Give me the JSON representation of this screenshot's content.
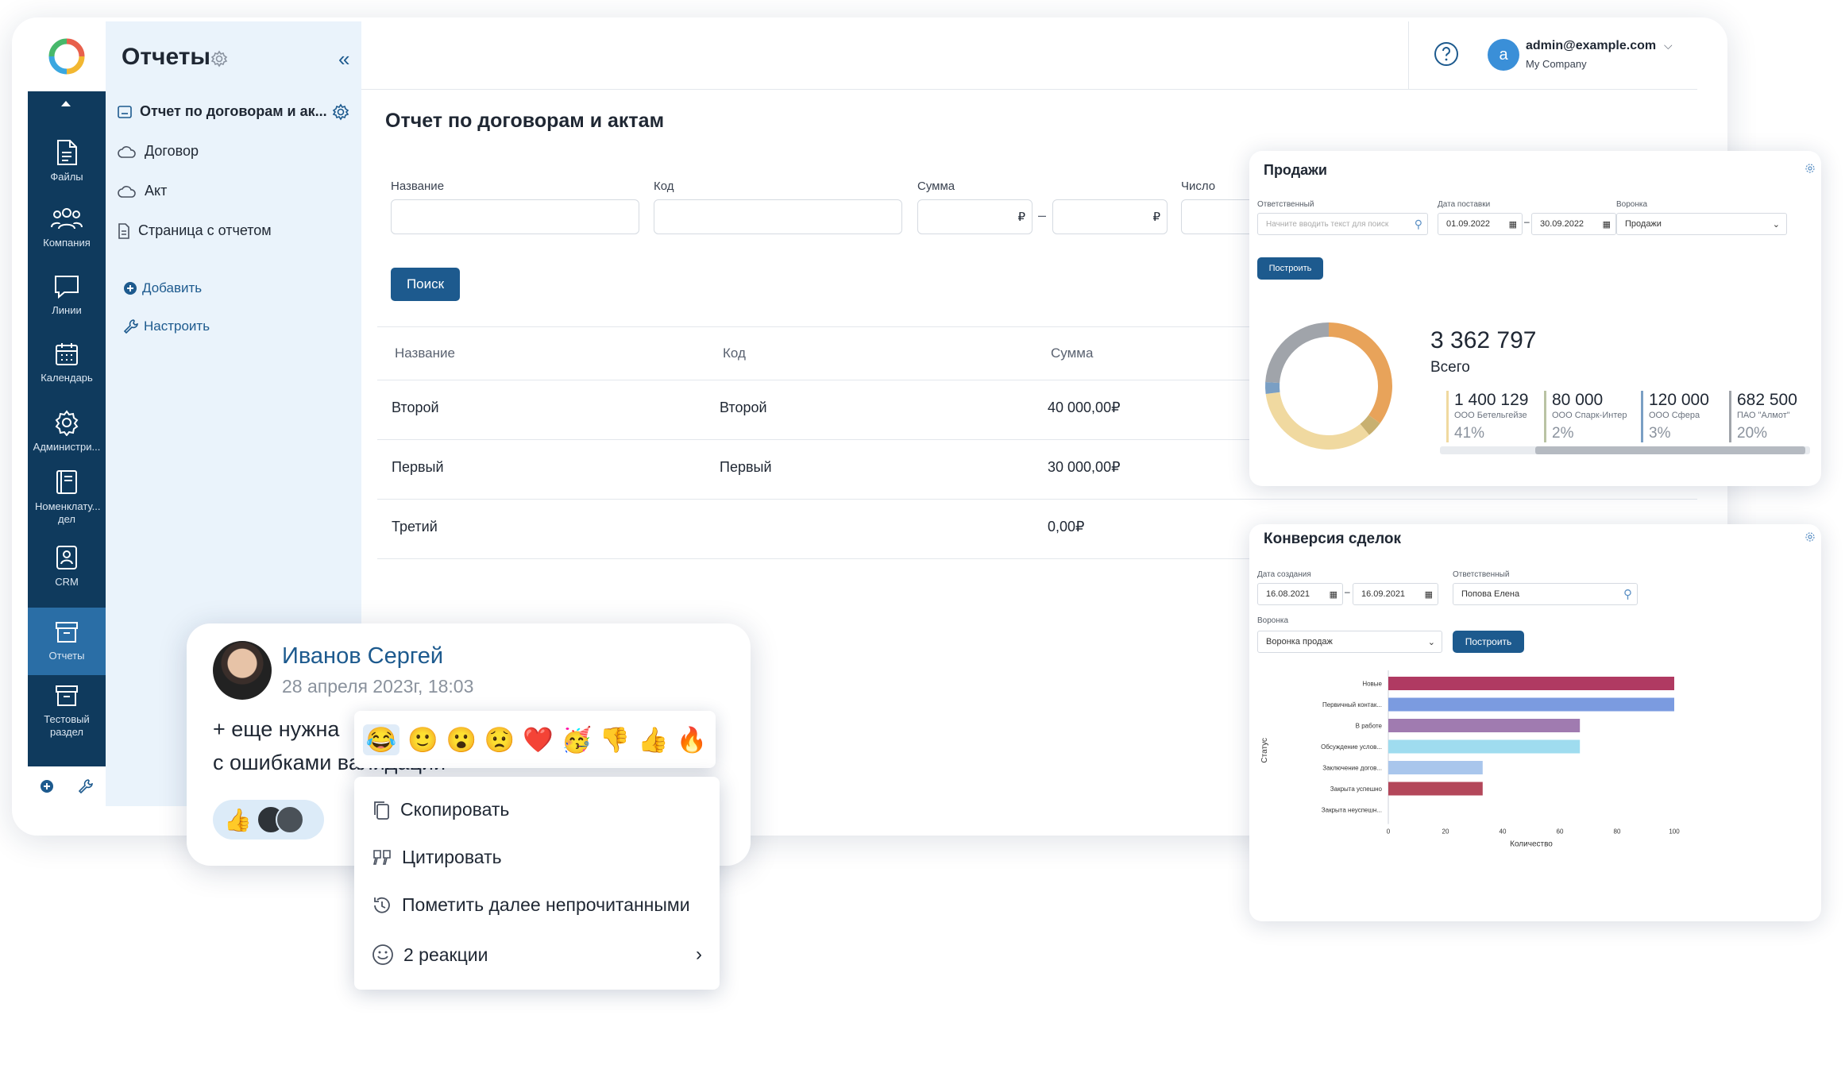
{
  "app": {
    "section_title": "Отчеты",
    "user_email": "admin@example.com",
    "user_company": "My Company",
    "avatar_letter": "a"
  },
  "rail": {
    "items": [
      {
        "label": "Файлы",
        "icon": "file-icon"
      },
      {
        "label": "Компания",
        "icon": "people-icon"
      },
      {
        "label": "Линии",
        "icon": "chat-icon"
      },
      {
        "label": "Календарь",
        "icon": "calendar-icon"
      },
      {
        "label": "Администри...",
        "icon": "gear-icon"
      },
      {
        "label": "Номенклату... дел",
        "icon": "book-icon"
      },
      {
        "label": "CRM",
        "icon": "crm-icon"
      },
      {
        "label": "Отчеты",
        "icon": "archive-icon"
      },
      {
        "label": "Тестовый раздел",
        "icon": "archive-icon"
      }
    ]
  },
  "panel": {
    "items": [
      {
        "label": "Отчет по договорам и ак..."
      },
      {
        "label": "Договор"
      },
      {
        "label": "Акт"
      },
      {
        "label": "Страница с отчетом"
      }
    ],
    "add_label": "Добавить",
    "configure_label": "Настроить"
  },
  "report": {
    "title": "Отчет по договорам и актам",
    "filters": {
      "name": "Название",
      "code": "Код",
      "sum": "Сумма",
      "number": "Число",
      "currency": "₽",
      "dash": "–"
    },
    "search_label": "Поиск",
    "columns": [
      "Название",
      "Код",
      "Сумма"
    ],
    "rows": [
      [
        "Второй",
        "Второй",
        "40 000,00₽"
      ],
      [
        "Первый",
        "Первый",
        "30 000,00₽"
      ],
      [
        "Третий",
        "",
        "0,00₽"
      ]
    ]
  },
  "sales_card": {
    "title": "Продажи",
    "responsible_label": "Ответственный",
    "responsible_placeholder": "Начните вводить текст для поиск",
    "date_label": "Дата поставки",
    "date_from": "01.09.2022",
    "date_to": "30.09.2022",
    "funnel_label": "Воронка",
    "funnel_value": "Продажи",
    "build_label": "Построить",
    "total_value": "3 362 797",
    "total_label": "Всего",
    "breakdown": [
      {
        "value": "1 400 129",
        "name": "ООО Бетельгейзе",
        "pct": "41%",
        "color": "#f0d9a0"
      },
      {
        "value": "80 000",
        "name": "ООО Спарк-Интер",
        "pct": "2%",
        "color": "#b9c3a3"
      },
      {
        "value": "120 000",
        "name": "ООО Сфера",
        "pct": "3%",
        "color": "#7a9fc4"
      },
      {
        "value": "682 500",
        "name": "ПАО \"Алмот\"",
        "pct": "20%",
        "color": "#a0a4aa"
      }
    ],
    "colors": {
      "orange": "#e8a35a",
      "tan": "#f0d9a0",
      "olive": "#c8b070",
      "blue": "#7a9fc4",
      "gray": "#a0a4aa"
    }
  },
  "conversion_card": {
    "title": "Конверсия сделок",
    "created_label": "Дата создания",
    "date_from": "16.08.2021",
    "date_to": "16.09.2021",
    "responsible_label": "Ответственный",
    "responsible_value": "Попова Елена",
    "funnel_label": "Воронка",
    "funnel_value": "Воронка продаж",
    "build_label": "Построить"
  },
  "chart_data": {
    "type": "bar",
    "orientation": "horizontal",
    "categories": [
      "Новые",
      "Первичный контак...",
      "В работе",
      "Обсуждение услов...",
      "Заключение догов...",
      "Закрыта успешно",
      "Закрыта неуспешн..."
    ],
    "values": [
      100,
      100,
      67,
      67,
      33,
      33,
      0
    ],
    "colors": [
      "#b03a62",
      "#7b9be0",
      "#a07bb0",
      "#9fdcef",
      "#a9c6ec",
      "#b3475a",
      "#cccccc"
    ],
    "xlabel": "Количество",
    "ylabel": "Статус",
    "xlim": [
      0,
      100
    ],
    "xticks": [
      "0",
      "20",
      "40",
      "60",
      "80",
      "100"
    ]
  },
  "chat": {
    "author": "Иванов Сергей",
    "date": "28 апреля 2023г, 18:03",
    "line1": "+ еще нужна",
    "line2": "с ошибками валидации",
    "reaction_emoji": "👍",
    "emojis": [
      "😂",
      "🙂",
      "😮",
      "😟",
      "❤️",
      "🥳",
      "👎",
      "👍",
      "🔥"
    ],
    "menu": {
      "copy": "Скопировать",
      "quote": "Цитировать",
      "mark_unread": "Пометить далее непрочитанными",
      "reactions": "2 реакции"
    }
  }
}
